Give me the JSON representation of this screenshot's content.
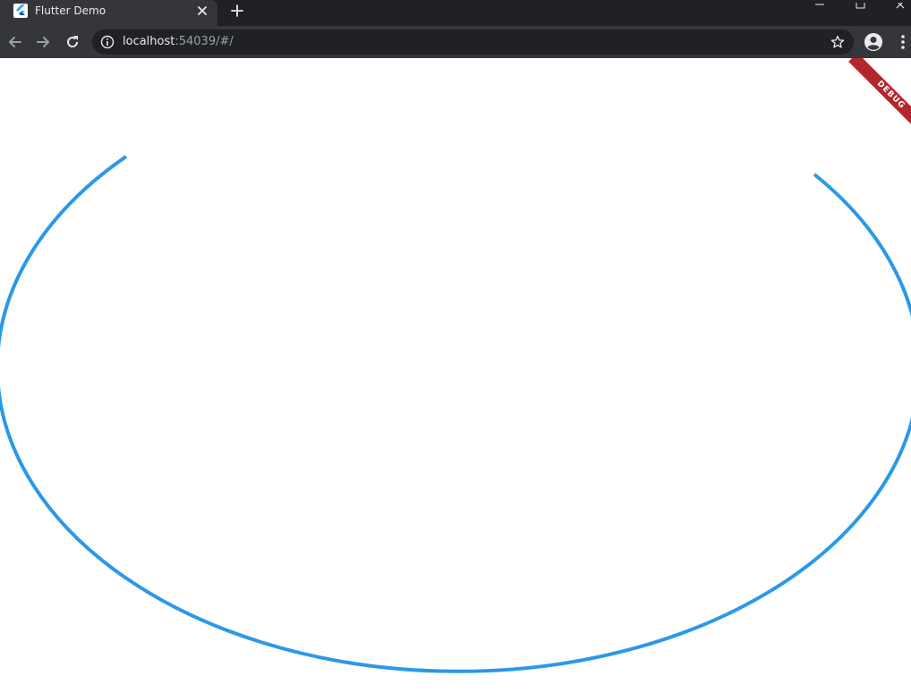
{
  "browser": {
    "tab": {
      "title": "Flutter Demo",
      "favicon": "flutter-logo-icon"
    },
    "window_controls": [
      "minimize-icon",
      "maximize-icon",
      "close-icon"
    ],
    "address_bar": {
      "host": "localhost",
      "rest": ":54039/#/"
    }
  },
  "page": {
    "background": "#ffffff",
    "debug_banner": "DEBUG",
    "arc": {
      "color": "#2b98e8"
    }
  },
  "colors": {
    "tabstrip": "#202124",
    "toolbar": "#35363a",
    "omnibox": "#202124",
    "debug_banner": "#b3262a"
  }
}
